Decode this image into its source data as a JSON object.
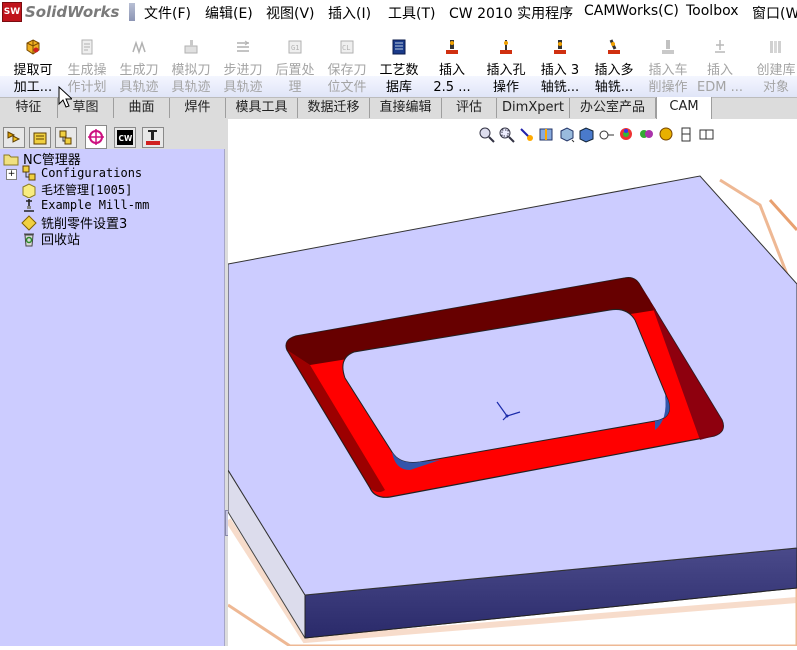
{
  "menu": {
    "brand": "SolidWorks",
    "items": [
      "文件(F)",
      "编辑(E)",
      "视图(V)",
      "插入(I)",
      "工具(T)",
      "CW 2010 实用程序",
      "CAMWorks(C)",
      "Toolbox",
      "窗口(W"
    ]
  },
  "commands": [
    {
      "l1": "提取可",
      "l2": "加工...",
      "icon": "extract-machinable-features-icon",
      "enabled": true
    },
    {
      "l1": "生成操",
      "l2": "作计划",
      "icon": "generate-operation-plan-icon",
      "enabled": false
    },
    {
      "l1": "生成刀",
      "l2": "具轨迹",
      "icon": "generate-toolpath-icon",
      "enabled": false
    },
    {
      "l1": "模拟刀",
      "l2": "具轨迹",
      "icon": "simulate-toolpath-icon",
      "enabled": false
    },
    {
      "l1": "步进刀",
      "l2": "具轨迹",
      "icon": "step-through-toolpath-icon",
      "enabled": false
    },
    {
      "l1": "后置处",
      "l2": "理",
      "icon": "post-process-icon",
      "enabled": false
    },
    {
      "l1": "保存刀",
      "l2": "位文件",
      "icon": "save-cl-file-icon",
      "enabled": false
    },
    {
      "l1": "工艺数",
      "l2": "据库",
      "icon": "technology-database-icon",
      "enabled": true
    },
    {
      "l1": "插入",
      "l2": "2.5 ...",
      "icon": "insert-2-5-axis-feature-icon",
      "enabled": true
    },
    {
      "l1": "插入孔",
      "l2": "操作",
      "icon": "insert-hole-operation-icon",
      "enabled": true
    },
    {
      "l1": "插入 3",
      "l2": "轴铣...",
      "icon": "insert-3-axis-mill-icon",
      "enabled": true
    },
    {
      "l1": "插入多",
      "l2": "轴铣...",
      "icon": "insert-multiaxis-mill-icon",
      "enabled": true
    },
    {
      "l1": "插入车",
      "l2": "削操作",
      "icon": "insert-turn-operation-icon",
      "enabled": false
    },
    {
      "l1": "插入",
      "l2": "EDM ...",
      "icon": "insert-edm-icon",
      "enabled": false
    },
    {
      "l1": "创建库",
      "l2": "对象",
      "icon": "create-library-object-icon",
      "enabled": false
    }
  ],
  "tabs": [
    "特征",
    "草图",
    "曲面",
    "焊件",
    "模具工具",
    "数据迁移",
    "直接编辑",
    "评估",
    "DimXpert",
    "办公室产品",
    "CAM"
  ],
  "active_tab": "CAM",
  "panel_tabs": [
    "feature-manager-icon",
    "property-manager-icon",
    "configuration-manager-icon",
    "dim-xpert-manager-icon",
    "camworks-feature-tree-icon",
    "camworks-operation-tree-icon"
  ],
  "tree": {
    "root": "NC管理器",
    "items": [
      {
        "label": "Configurations",
        "icon": "configurations-icon"
      },
      {
        "label": "毛坯管理[1005]",
        "icon": "stock-manager-icon"
      },
      {
        "label": "Example Mill-mm",
        "icon": "machine-icon"
      },
      {
        "label": "铣削零件设置3",
        "icon": "mill-part-setup-icon"
      },
      {
        "label": "回收站",
        "icon": "recycle-bin-icon"
      }
    ]
  },
  "view_tools": [
    "zoom-to-fit-icon",
    "zoom-to-area-icon",
    "previous-view-icon",
    "section-view-icon",
    "view-orientation-icon",
    "display-style-icon",
    "hide-show-items-icon",
    "edit-appearance-icon",
    "apply-scene-icon",
    "view-settings-icon",
    "split-horizontal-icon",
    "split-vertical-icon"
  ],
  "colors": {
    "tree_bg": "#ccccff",
    "part_top": "#ccccff",
    "pocket_wall": "#ff0000",
    "pocket_dark": "#5a0000",
    "part_side": "#3a3a7a",
    "stock_outline": "#e8a070"
  }
}
